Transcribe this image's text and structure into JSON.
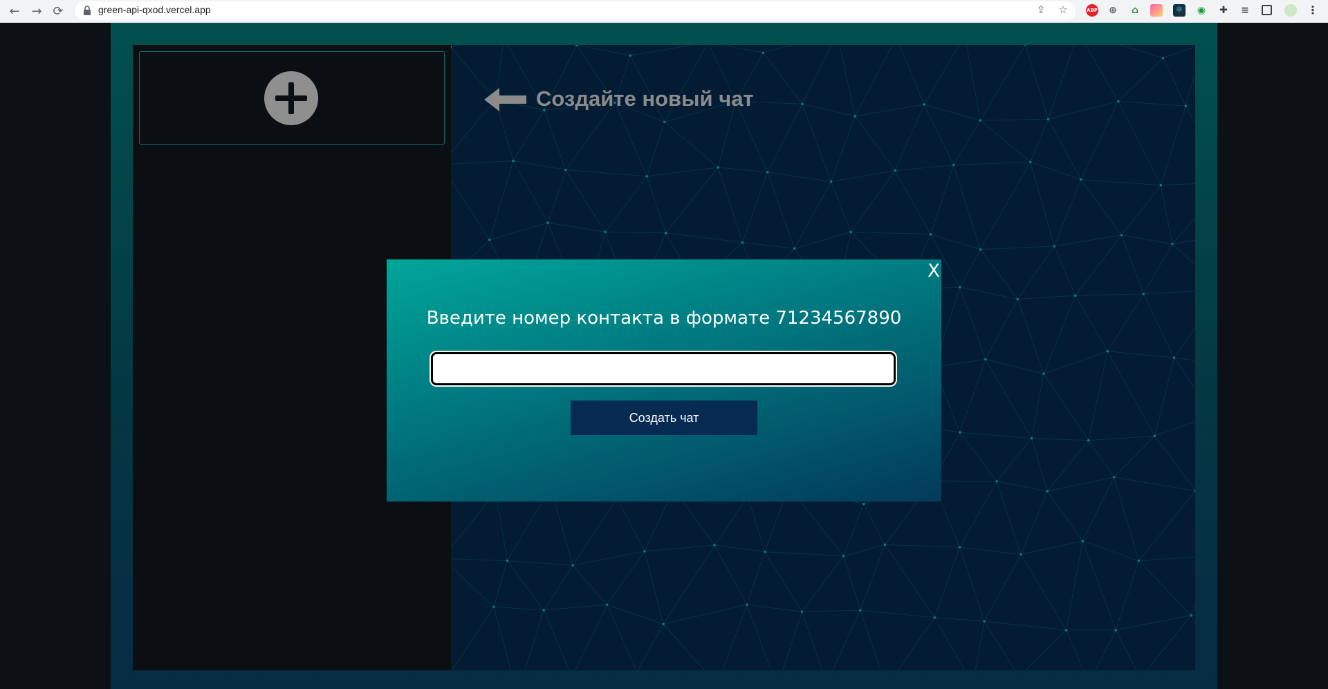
{
  "browser": {
    "url": "green-api-qxod.vercel.app",
    "extensions": [
      "share-icon",
      "star-icon",
      "adblock-icon",
      "translate-icon",
      "home-icon",
      "gradient-ext-icon",
      "react-icon",
      "search-ext-icon",
      "puzzle-icon",
      "reading-list-icon",
      "sidepanel-icon",
      "profile-avatar",
      "menu-icon"
    ],
    "adblock_label": "ABP"
  },
  "sidebar": {
    "new_chat_icon": "plus-circle-icon"
  },
  "main": {
    "hint_text": "Создайте новый чат",
    "hint_icon": "arrow-left-icon"
  },
  "modal": {
    "close_label": "X",
    "title": "Введите номер контакта в формате 71234567890",
    "input_value": "",
    "input_placeholder": "",
    "button_label": "Создать чат"
  },
  "colors": {
    "frame": "#01504f",
    "main_bg": "#031b33",
    "sidebar_bg": "#0b0f13",
    "modal_top": "#00a69a",
    "modal_bottom": "#033a5a",
    "button_bg": "#062a52",
    "accent_border": "#0e6e63"
  }
}
